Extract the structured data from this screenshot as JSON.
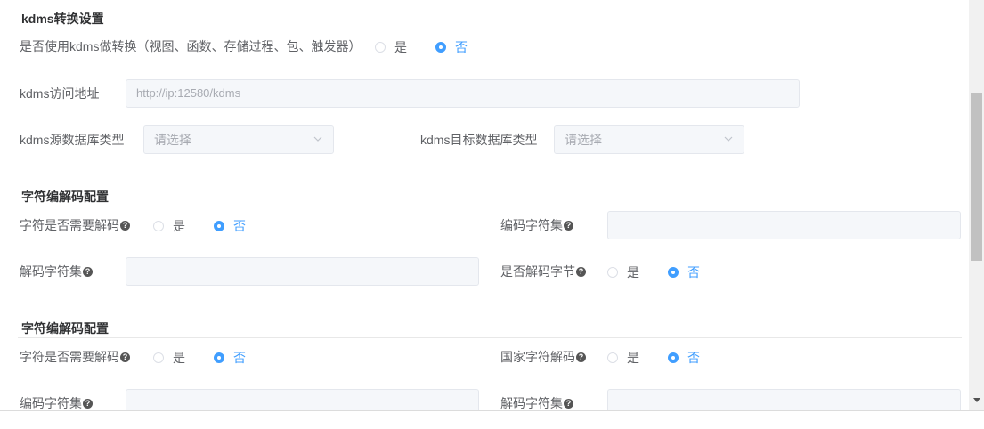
{
  "kdms": {
    "title": "kdms转换设置",
    "use_label": "是否使用kdms做转换（视图、函数、存储过程、包、触发器）",
    "yes": "是",
    "no": "否",
    "url_label": "kdms访问地址",
    "url_placeholder": "http://ip:12580/kdms",
    "src_label": "kdms源数据库类型",
    "src_placeholder": "请选择",
    "tgt_label": "kdms目标数据库类型",
    "tgt_placeholder": "请选择"
  },
  "charset1": {
    "title": "字符编解码配置",
    "need_decode_label": "字符是否需要解码",
    "encode_charset_label": "编码字符集",
    "decode_charset_label": "解码字符集",
    "decode_bytes_label": "是否解码字节",
    "yes": "是",
    "no": "否"
  },
  "charset2": {
    "title": "字符编解码配置",
    "need_decode_label": "字符是否需要解码",
    "national_decode_label": "国家字符解码",
    "encode_charset_label": "编码字符集",
    "decode_charset_label": "解码字符集",
    "yes": "是",
    "no": "否"
  },
  "help_glyph": "?"
}
